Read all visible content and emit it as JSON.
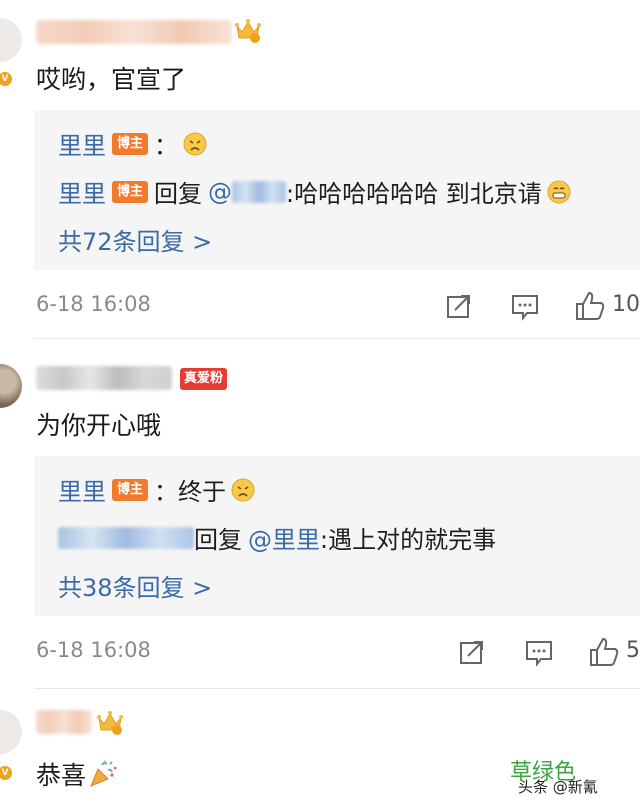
{
  "comments": [
    {
      "text": "哎哟，官宣了",
      "replies": [
        {
          "user": "里里",
          "badge": "博主",
          "sep": "：",
          "content": ""
        },
        {
          "user": "里里",
          "badge": "博主",
          "reply_word": "回复",
          "at": "@",
          "content": ":哈哈哈哈哈哈 到北京请"
        }
      ],
      "more_replies": "共72条回复 >",
      "time": "6-18 16:08",
      "likes": "10"
    },
    {
      "fan_badge": "真爱粉",
      "text": "为你开心哦",
      "replies": [
        {
          "user": "里里",
          "badge": "博主",
          "content": "：终于"
        },
        {
          "reply_word": "回复",
          "at_user": "@里里",
          "content": ":遇上对的就完事"
        }
      ],
      "more_replies": "共38条回复 >",
      "time": "6-18 16:08",
      "likes": "5"
    },
    {
      "text": "恭喜"
    }
  ],
  "watermark": {
    "line1": "草绿色",
    "line2": "头条 @新氰"
  }
}
